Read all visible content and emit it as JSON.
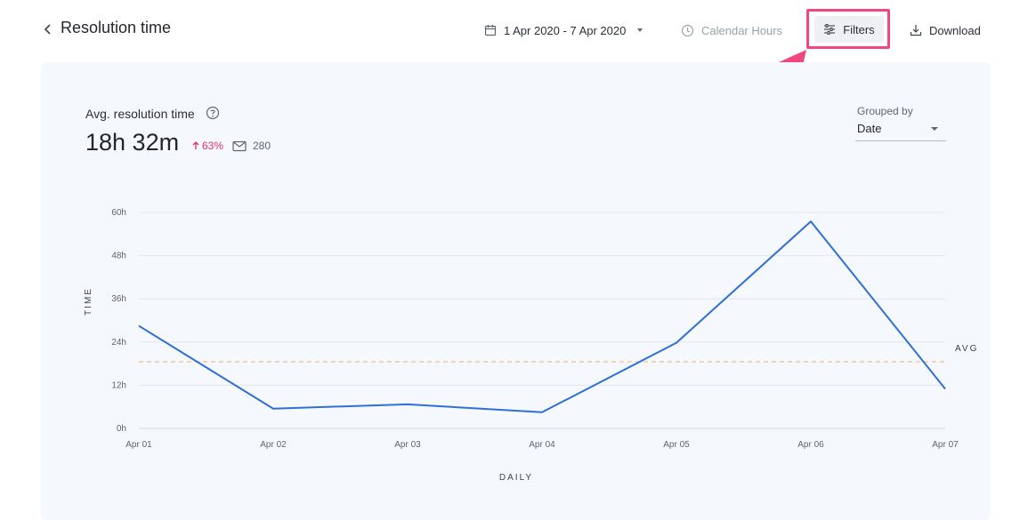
{
  "header": {
    "title": "Resolution time",
    "date_range": "1 Apr 2020 - 7 Apr 2020",
    "calendar_hours": "Calendar Hours",
    "filters_label": "Filters",
    "download_label": "Download"
  },
  "metric": {
    "label": "Avg. resolution time",
    "value": "18h 32m",
    "change": "63%",
    "count": "280"
  },
  "grouped_by": {
    "label": "Grouped by",
    "value": "Date"
  },
  "colors": {
    "line": "#2f6fd6",
    "avg_line": "#f2c7a6",
    "highlight": "#f2477e",
    "trend_up": "#e4336b"
  },
  "icons": [
    "chevron-left-icon",
    "calendar-icon",
    "caret-down-icon",
    "clock-icon",
    "filter-sliders-icon",
    "download-icon",
    "help-icon",
    "arrow-up-icon",
    "mail-icon"
  ],
  "chart_data": {
    "type": "line",
    "categories": [
      "Apr 01",
      "Apr 02",
      "Apr 03",
      "Apr 04",
      "Apr 05",
      "Apr 06",
      "Apr 07"
    ],
    "values": [
      28.5,
      5.5,
      6.7,
      4.5,
      23.8,
      57.5,
      11
    ],
    "y_ticks": [
      "0h",
      "12h",
      "24h",
      "36h",
      "48h",
      "60h"
    ],
    "ylim": [
      0,
      60
    ],
    "avg": 18.53,
    "avg_label": "AVG",
    "xlabel": "DAILY",
    "ylabel": "TIME",
    "grid": true
  }
}
